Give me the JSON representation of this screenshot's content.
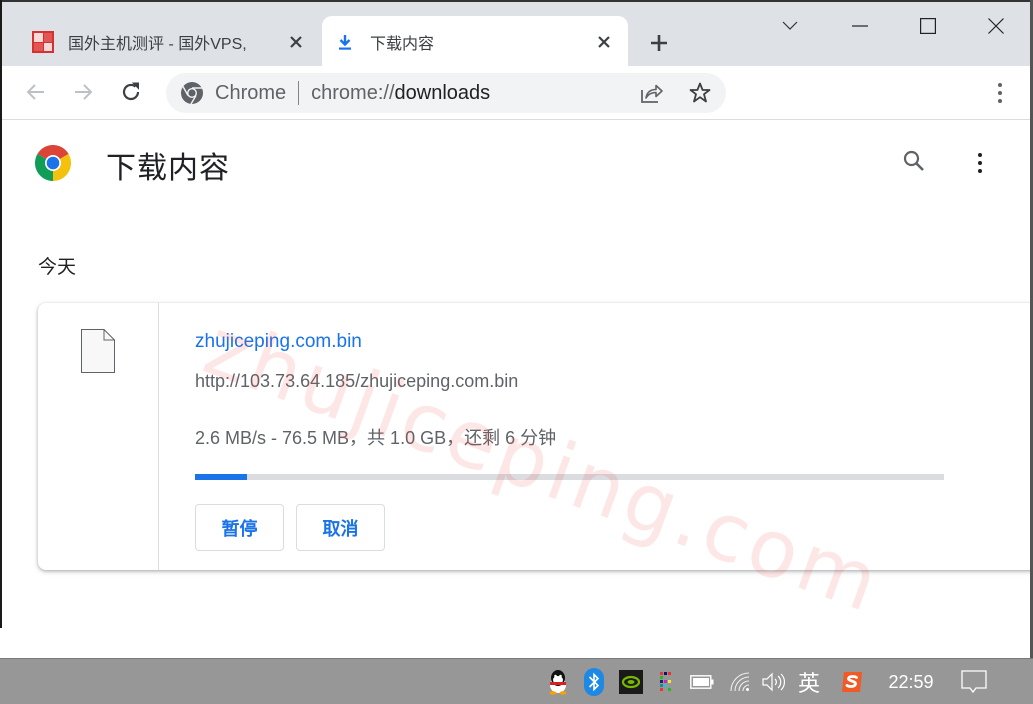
{
  "window": {
    "tabs": [
      {
        "title": "国外主机测评 - 国外VPS,",
        "favicon": "site-logo-icon",
        "active": false
      },
      {
        "title": "下载内容",
        "favicon": "download-icon",
        "active": true
      }
    ],
    "new_tab_label": "+",
    "controls": [
      "tab-search-chevron",
      "minimize",
      "maximize",
      "close"
    ]
  },
  "toolbar": {
    "omnibox": {
      "chip": "Chrome",
      "url_scheme": "chrome://",
      "url_host": "downloads"
    }
  },
  "page": {
    "title": "下载内容",
    "section_date": "今天",
    "download": {
      "file_name": "zhujiceping.com.bin",
      "url": "http://103.73.64.185/zhujiceping.com.bin",
      "status": "2.6 MB/s - 76.5 MB，共 1.0 GB，还剩 6 分钟",
      "progress_fraction": 0.07,
      "pause_label": "暂停",
      "cancel_label": "取消"
    },
    "watermark": "zhujiceping.com"
  },
  "colors": {
    "accent": "#1a73e8",
    "titlebar": "#dee1e6",
    "taskbar": "#979797"
  },
  "taskbar": {
    "tray_icons": [
      "qq-icon",
      "bluetooth-icon",
      "nvidia-icon",
      "color-grid-icon",
      "battery-icon",
      "wifi-icon",
      "volume-icon",
      "ime-icon",
      "sogou-icon"
    ],
    "ime_label": "英",
    "clock": "22:59"
  }
}
